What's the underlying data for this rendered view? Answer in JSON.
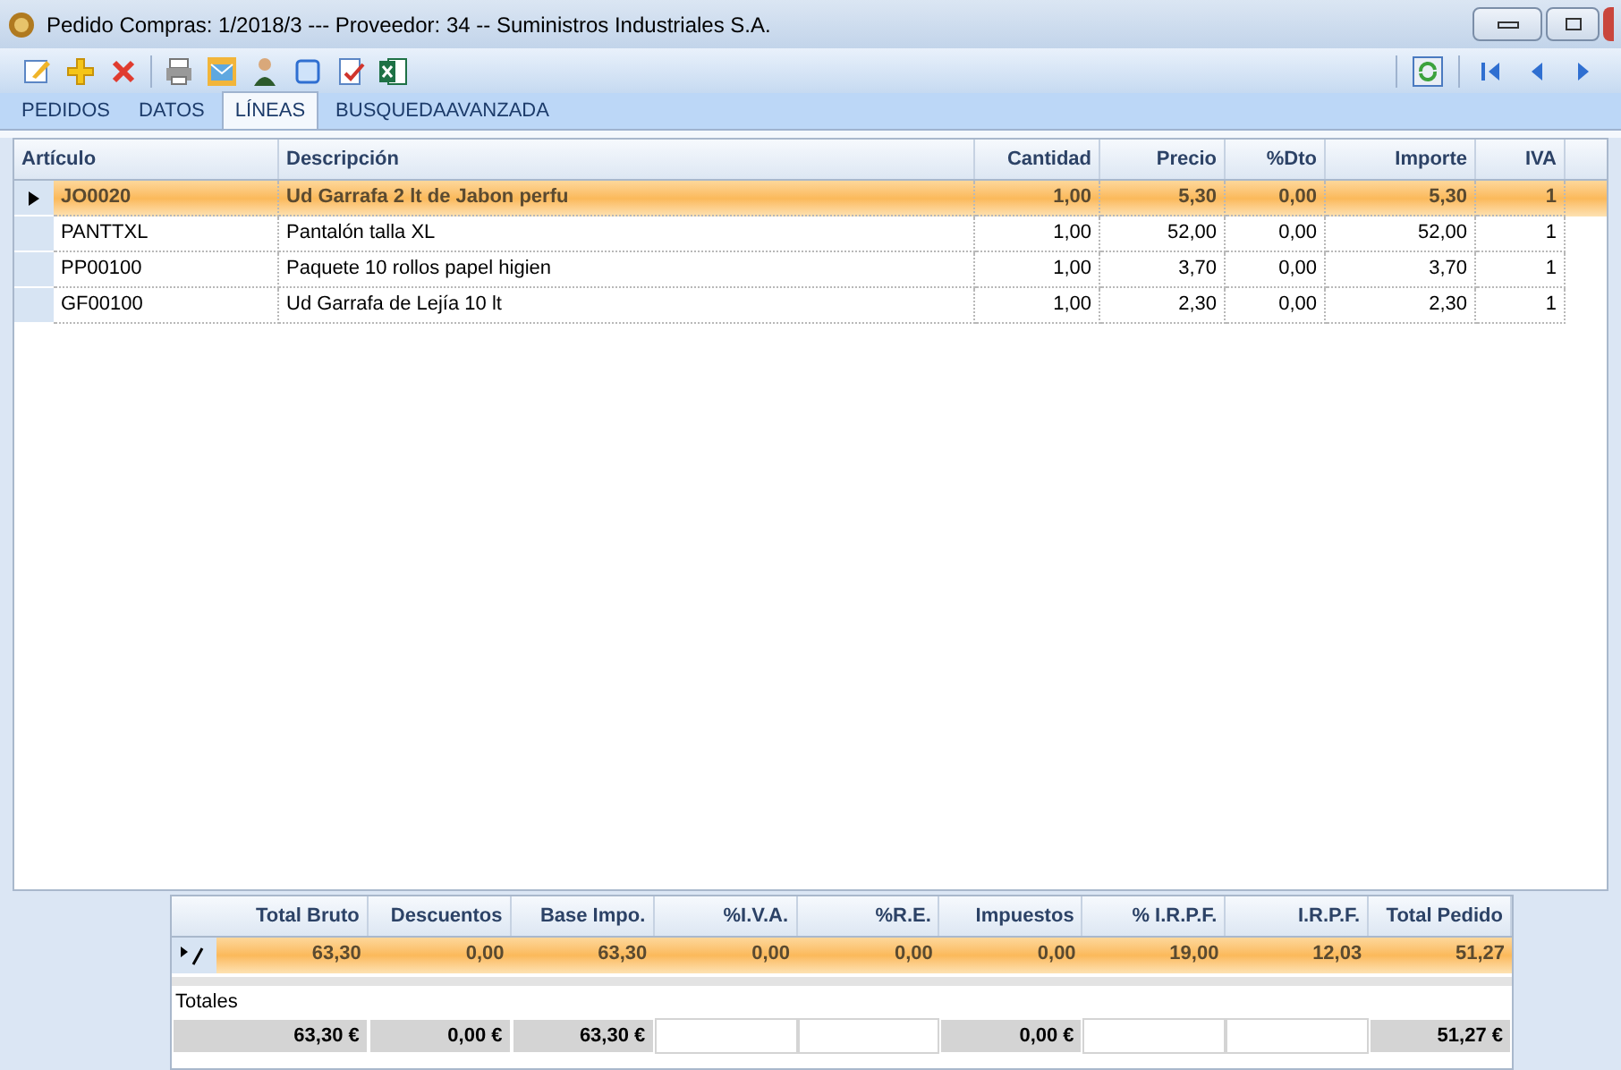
{
  "window": {
    "title": "Pedido Compras: 1/2018/3  ---  Proveedor: 34  --  Suministros Industriales S.A."
  },
  "tabs": [
    {
      "label": "PEDIDOS",
      "selected": false
    },
    {
      "label": "DATOS",
      "selected": false
    },
    {
      "label": "LÍNEAS",
      "selected": true
    },
    {
      "label": "BUSQUEDAAVANZADA",
      "selected": false
    }
  ],
  "table": {
    "columns": [
      "Artículo",
      "Descripción",
      "Cantidad",
      "Precio",
      "%Dto",
      "Importe",
      "IVA"
    ],
    "rows": [
      {
        "selected": true,
        "cells": [
          "JO0020",
          "Ud Garrafa 2 lt de Jabon perfu",
          "1,00",
          "5,30",
          "0,00",
          "5,30",
          "1"
        ]
      },
      {
        "selected": false,
        "cells": [
          "PANTTXL",
          "Pantalón talla XL",
          "1,00",
          "52,00",
          "0,00",
          "52,00",
          "1"
        ]
      },
      {
        "selected": false,
        "cells": [
          "PP00100",
          "Paquete 10 rollos papel higien",
          "1,00",
          "3,70",
          "0,00",
          "3,70",
          "1"
        ]
      },
      {
        "selected": false,
        "cells": [
          "GF00100",
          "Ud Garrafa de Lejía 10 lt",
          "1,00",
          "2,30",
          "0,00",
          "2,30",
          "1"
        ]
      }
    ]
  },
  "summary": {
    "columns": [
      "Total Bruto",
      "Descuentos",
      "Base Impo.",
      "%I.V.A.",
      "%R.E.",
      "Impuestos",
      "% I.R.P.F.",
      "I.R.P.F.",
      "Total Pedido"
    ],
    "row": [
      "63,30",
      "0,00",
      "63,30",
      "0,00",
      "0,00",
      "0,00",
      "19,00",
      "12,03",
      "51,27"
    ],
    "totals_label": "Totales",
    "totals": [
      {
        "kind": "sum",
        "value": "63,30 €"
      },
      {
        "kind": "sum",
        "value": "0,00 €"
      },
      {
        "kind": "sum",
        "value": "63,30 €"
      },
      {
        "kind": "blank"
      },
      {
        "kind": "blank"
      },
      {
        "kind": "sum",
        "value": "0,00 €"
      },
      {
        "kind": "blank"
      },
      {
        "kind": "blank"
      },
      {
        "kind": "sum",
        "value": "51,27 €"
      }
    ]
  }
}
